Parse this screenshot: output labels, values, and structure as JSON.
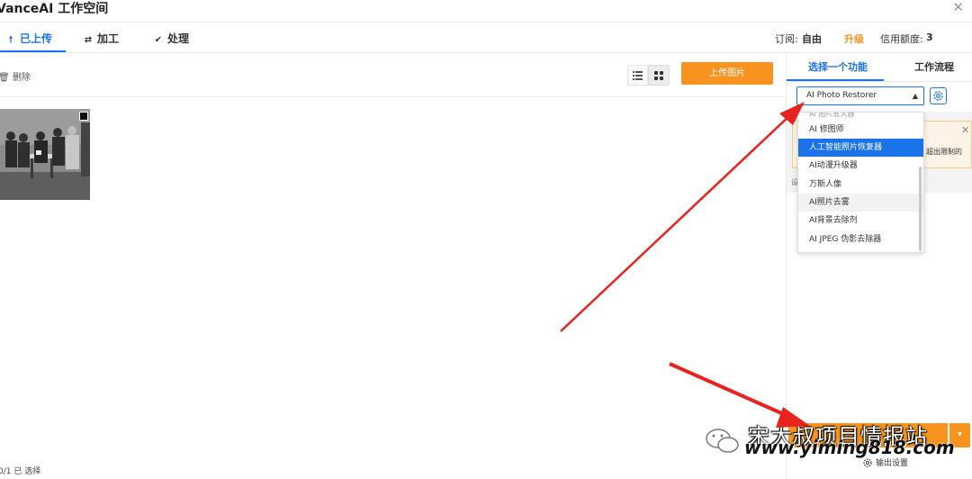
{
  "app": {
    "title": "VanceAI 工作空间"
  },
  "tabs": [
    {
      "label": "已上传",
      "icon": "upload-arrow-icon"
    },
    {
      "label": "加工",
      "icon": "swap-icon"
    },
    {
      "label": "处理",
      "icon": "check-circle-icon"
    }
  ],
  "subscription": {
    "label": "订阅:",
    "plan": "自由",
    "upgrade": "升级",
    "credits_label": "信用额度:",
    "credits_value": "3"
  },
  "toolbar": {
    "delete_label": "删除",
    "upload_label": "上传图片"
  },
  "footer": {
    "status": "0/1 已  选择"
  },
  "right_panel": {
    "tabs": [
      "选择一个功能",
      "工作流程"
    ],
    "select_value": "AI Photo Restorer",
    "dropdown_cut_item": "AI 图片放大器",
    "dropdown_items": [
      "AI 修图师",
      "人工智能照片恢复器",
      "AI动漫升级器",
      "万斯人像",
      "AI照片去雾",
      "AI背景去除剂",
      "AI JPEG 伪影去除器"
    ],
    "selected_index": 1,
    "hover_index": 4,
    "warning_text": "超出限制的",
    "misc_char": "设",
    "output_settings": "输出设置"
  },
  "watermark": {
    "line1": "宋大叔项目情报站",
    "line2": "www.yiming818.com"
  },
  "colors": {
    "accent": "#1a73e8",
    "orange": "#f7931e",
    "arrow": "#e8231f"
  }
}
